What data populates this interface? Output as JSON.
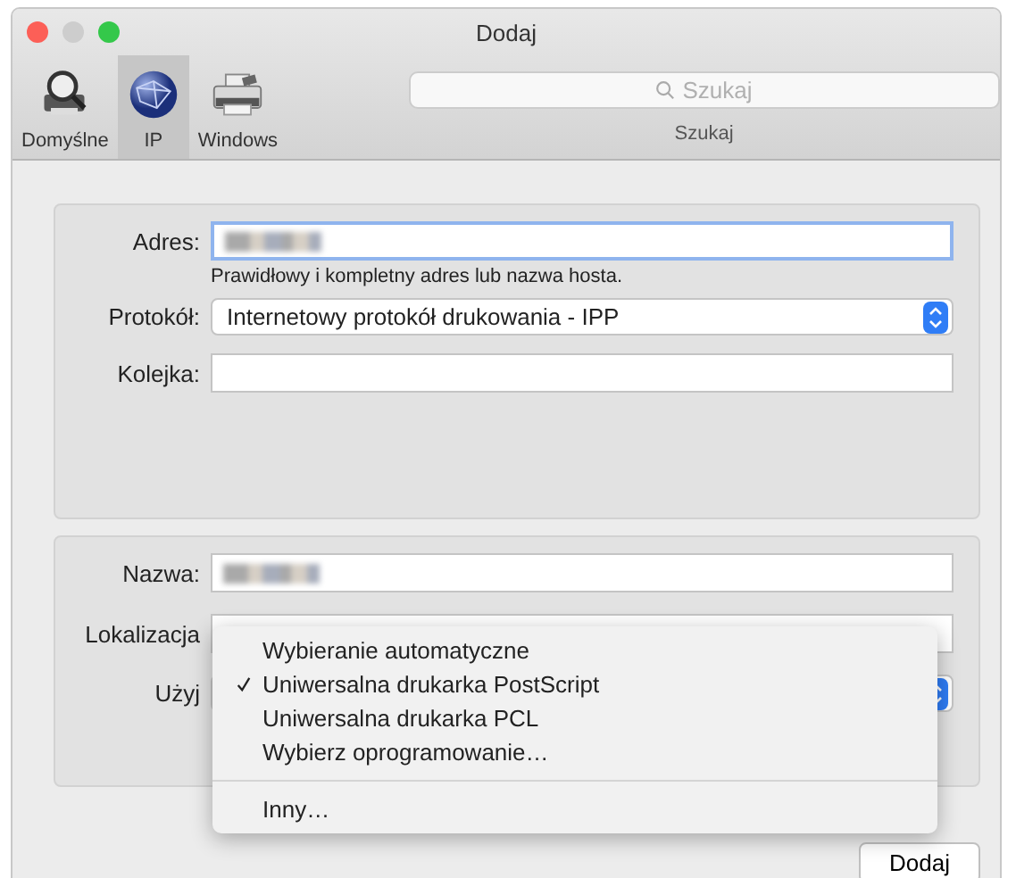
{
  "window": {
    "title": "Dodaj"
  },
  "toolbar": {
    "tabs": [
      {
        "label": "Domyślne",
        "selected": false,
        "kind": "default"
      },
      {
        "label": "IP",
        "selected": true,
        "kind": "ip"
      },
      {
        "label": "Windows",
        "selected": false,
        "kind": "windows"
      }
    ],
    "search": {
      "placeholder": "Szukaj",
      "label": "Szukaj"
    }
  },
  "address_section": {
    "address": {
      "label": "Adres:",
      "redacted": true,
      "focused": true
    },
    "hint": "Prawidłowy i kompletny adres lub nazwa hosta.",
    "protocol": {
      "label": "Protokół:",
      "value": "Internetowy protokół drukowania - IPP"
    },
    "queue": {
      "label": "Kolejka:"
    }
  },
  "printer_section": {
    "name": {
      "label": "Nazwa:",
      "redacted": true
    },
    "location": {
      "label": "Lokalizacja"
    },
    "use": {
      "label": "Użyj"
    }
  },
  "menu": {
    "items": [
      {
        "label": "Wybieranie automatyczne",
        "selected": false
      },
      {
        "label": "Uniwersalna drukarka PostScript",
        "selected": true
      },
      {
        "label": "Uniwersalna drukarka PCL",
        "selected": false
      },
      {
        "label": "Wybierz oprogramowanie…",
        "selected": false
      }
    ],
    "other": "Inny…"
  },
  "buttons": [
    {
      "label": "Dodaj"
    }
  ]
}
